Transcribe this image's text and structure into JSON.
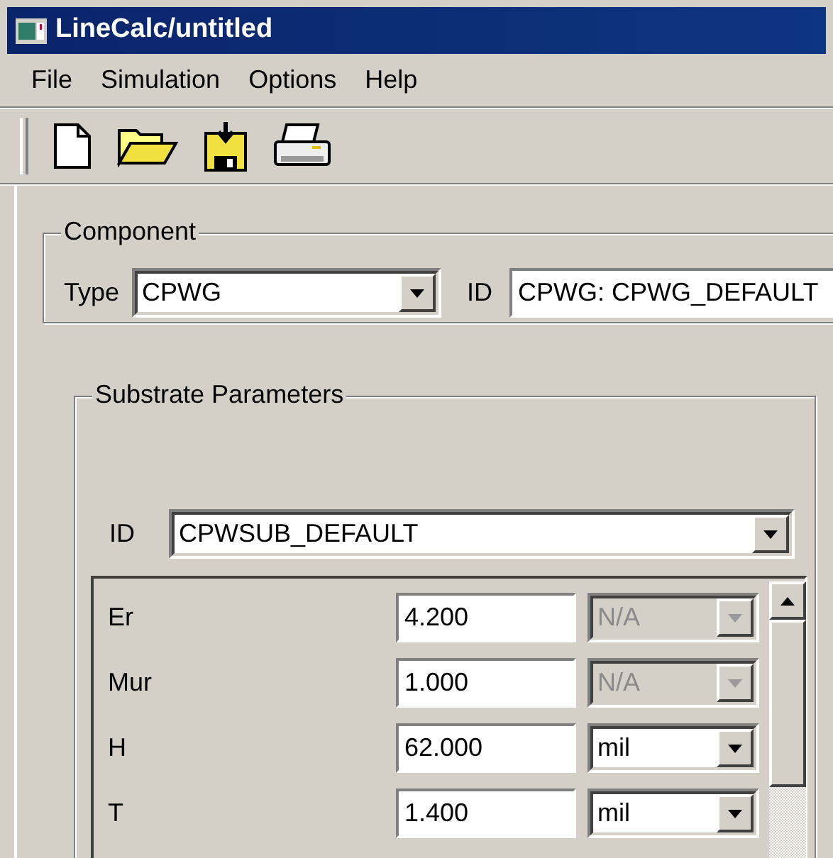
{
  "window": {
    "title": "LineCalc/untitled"
  },
  "menu": [
    "File",
    "Simulation",
    "Options",
    "Help"
  ],
  "component": {
    "legend": "Component",
    "type_label": "Type",
    "type_value": "CPWG",
    "id_label": "ID",
    "id_value": "CPWG: CPWG_DEFAULT"
  },
  "substrate": {
    "legend": "Substrate Parameters",
    "id_label": "ID",
    "id_value": "CPWSUB_DEFAULT",
    "params": [
      {
        "name": "Er",
        "value": "4.200",
        "unit": "N/A",
        "disabled": true
      },
      {
        "name": "Mur",
        "value": "1.000",
        "unit": "N/A",
        "disabled": true
      },
      {
        "name": "H",
        "value": "62.000",
        "unit": "mil",
        "disabled": false
      },
      {
        "name": "T",
        "value": "1.400",
        "unit": "mil",
        "disabled": false
      }
    ]
  }
}
